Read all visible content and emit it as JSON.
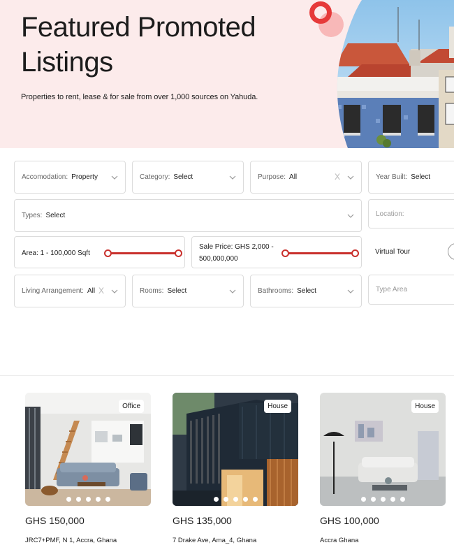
{
  "hero": {
    "title_line1": "Featured Promoted",
    "title_line2": "Listings",
    "subtitle": "Properties to rent, lease & for sale from over 1,000 sources on Yahuda."
  },
  "filters": {
    "accomodation": {
      "label": "Accomodation:",
      "value": "Property"
    },
    "category": {
      "label": "Category:",
      "value": "Select"
    },
    "purpose": {
      "label": "Purpose:",
      "value": "All"
    },
    "year_built": {
      "label": "Year Built:",
      "value": "Select"
    },
    "types": {
      "label": "Types:",
      "value": "Select"
    },
    "location": {
      "placeholder": "Location:"
    },
    "area": {
      "label": "Area: 1 - 100,000 Sqft"
    },
    "sale_price": {
      "label_line1": "Sale Price: GHS 2,000 -",
      "label_line2": "500,000,000"
    },
    "virtual_tour": {
      "label": "Virtual Tour"
    },
    "living_arrangement": {
      "label": "Living Arrangement:",
      "value": "All"
    },
    "rooms": {
      "label": "Rooms:",
      "value": "Select"
    },
    "bathrooms": {
      "label": "Bathrooms:",
      "value": "Select"
    },
    "type_area": {
      "placeholder": "Type Area"
    },
    "clear_glyph": "X"
  },
  "listings": [
    {
      "badge": "Office",
      "price": "GHS 150,000",
      "address": "JRC7+PMF, N 1, Accra, Ghana"
    },
    {
      "badge": "House",
      "price": "GHS 135,000",
      "address": "7 Drake Ave, Ama_4, Ghana"
    },
    {
      "badge": "House",
      "price": "GHS 100,000",
      "address": "Accra Ghana"
    }
  ],
  "colors": {
    "accent": "#c9302c",
    "hero_bg": "#fcebeb"
  }
}
